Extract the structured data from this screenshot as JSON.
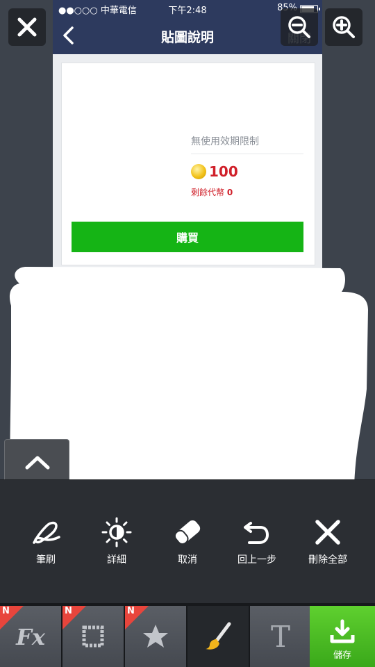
{
  "status_bar": {
    "carrier": "●●○○○ 中華電信",
    "time": "下午2:48",
    "battery": "85%"
  },
  "nav": {
    "title": "貼圖說明",
    "close_label": "關閉"
  },
  "sticker_info": {
    "validity": "無使用效期限制",
    "price": "100",
    "remaining_label": "剩餘代幣",
    "remaining_value": "0",
    "buy_label": "購買"
  },
  "tools": [
    {
      "icon": "brush-icon",
      "label": "筆刷"
    },
    {
      "icon": "brightness-icon",
      "label": "詳細"
    },
    {
      "icon": "eraser-icon",
      "label": "取消"
    },
    {
      "icon": "undo-icon",
      "label": "回上一步"
    },
    {
      "icon": "delete-all-icon",
      "label": "刪除全部"
    }
  ],
  "tabs": [
    {
      "icon": "fx-icon",
      "label": "Fx",
      "badge": "N"
    },
    {
      "icon": "frame-icon",
      "badge": "N"
    },
    {
      "icon": "star-icon",
      "badge": "N"
    },
    {
      "icon": "brush-tab-icon",
      "active": true
    },
    {
      "icon": "text-icon",
      "label": "T"
    },
    {
      "icon": "download-icon",
      "label": "儲存"
    }
  ],
  "colors": {
    "buy_button": "#15b415",
    "price": "#d0202a",
    "nav_bar": "#2d3a5e",
    "save_tab": "#4cc025",
    "new_badge": "#e8453c"
  }
}
